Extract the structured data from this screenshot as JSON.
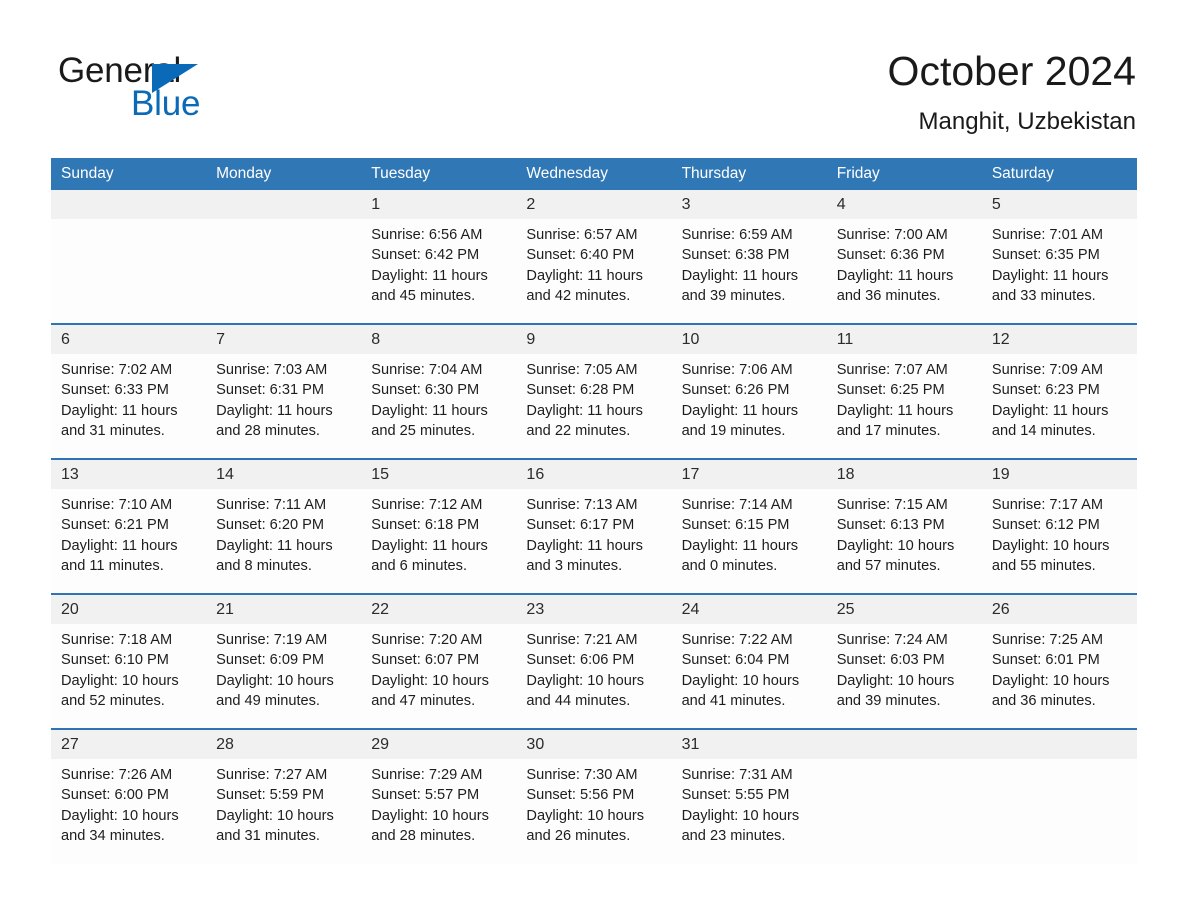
{
  "brand": {
    "name_part1": "General",
    "name_part2": "Blue",
    "triangle_icon": "triangle-icon",
    "accent_color": "#0b6ab8"
  },
  "header": {
    "month_title": "October 2024",
    "location": "Manghit, Uzbekistan"
  },
  "theme": {
    "header_blue": "#3077b5",
    "rule_blue": "#2e74b5",
    "daynum_band": "#f1f1f1"
  },
  "calendar": {
    "day_headers": [
      "Sunday",
      "Monday",
      "Tuesday",
      "Wednesday",
      "Thursday",
      "Friday",
      "Saturday"
    ],
    "weeks": [
      [
        {
          "day": "",
          "sunrise": "",
          "sunset": "",
          "daylight": ""
        },
        {
          "day": "",
          "sunrise": "",
          "sunset": "",
          "daylight": ""
        },
        {
          "day": "1",
          "sunrise": "Sunrise: 6:56 AM",
          "sunset": "Sunset: 6:42 PM",
          "daylight": "Daylight: 11 hours and 45 minutes."
        },
        {
          "day": "2",
          "sunrise": "Sunrise: 6:57 AM",
          "sunset": "Sunset: 6:40 PM",
          "daylight": "Daylight: 11 hours and 42 minutes."
        },
        {
          "day": "3",
          "sunrise": "Sunrise: 6:59 AM",
          "sunset": "Sunset: 6:38 PM",
          "daylight": "Daylight: 11 hours and 39 minutes."
        },
        {
          "day": "4",
          "sunrise": "Sunrise: 7:00 AM",
          "sunset": "Sunset: 6:36 PM",
          "daylight": "Daylight: 11 hours and 36 minutes."
        },
        {
          "day": "5",
          "sunrise": "Sunrise: 7:01 AM",
          "sunset": "Sunset: 6:35 PM",
          "daylight": "Daylight: 11 hours and 33 minutes."
        }
      ],
      [
        {
          "day": "6",
          "sunrise": "Sunrise: 7:02 AM",
          "sunset": "Sunset: 6:33 PM",
          "daylight": "Daylight: 11 hours and 31 minutes."
        },
        {
          "day": "7",
          "sunrise": "Sunrise: 7:03 AM",
          "sunset": "Sunset: 6:31 PM",
          "daylight": "Daylight: 11 hours and 28 minutes."
        },
        {
          "day": "8",
          "sunrise": "Sunrise: 7:04 AM",
          "sunset": "Sunset: 6:30 PM",
          "daylight": "Daylight: 11 hours and 25 minutes."
        },
        {
          "day": "9",
          "sunrise": "Sunrise: 7:05 AM",
          "sunset": "Sunset: 6:28 PM",
          "daylight": "Daylight: 11 hours and 22 minutes."
        },
        {
          "day": "10",
          "sunrise": "Sunrise: 7:06 AM",
          "sunset": "Sunset: 6:26 PM",
          "daylight": "Daylight: 11 hours and 19 minutes."
        },
        {
          "day": "11",
          "sunrise": "Sunrise: 7:07 AM",
          "sunset": "Sunset: 6:25 PM",
          "daylight": "Daylight: 11 hours and 17 minutes."
        },
        {
          "day": "12",
          "sunrise": "Sunrise: 7:09 AM",
          "sunset": "Sunset: 6:23 PM",
          "daylight": "Daylight: 11 hours and 14 minutes."
        }
      ],
      [
        {
          "day": "13",
          "sunrise": "Sunrise: 7:10 AM",
          "sunset": "Sunset: 6:21 PM",
          "daylight": "Daylight: 11 hours and 11 minutes."
        },
        {
          "day": "14",
          "sunrise": "Sunrise: 7:11 AM",
          "sunset": "Sunset: 6:20 PM",
          "daylight": "Daylight: 11 hours and 8 minutes."
        },
        {
          "day": "15",
          "sunrise": "Sunrise: 7:12 AM",
          "sunset": "Sunset: 6:18 PM",
          "daylight": "Daylight: 11 hours and 6 minutes."
        },
        {
          "day": "16",
          "sunrise": "Sunrise: 7:13 AM",
          "sunset": "Sunset: 6:17 PM",
          "daylight": "Daylight: 11 hours and 3 minutes."
        },
        {
          "day": "17",
          "sunrise": "Sunrise: 7:14 AM",
          "sunset": "Sunset: 6:15 PM",
          "daylight": "Daylight: 11 hours and 0 minutes."
        },
        {
          "day": "18",
          "sunrise": "Sunrise: 7:15 AM",
          "sunset": "Sunset: 6:13 PM",
          "daylight": "Daylight: 10 hours and 57 minutes."
        },
        {
          "day": "19",
          "sunrise": "Sunrise: 7:17 AM",
          "sunset": "Sunset: 6:12 PM",
          "daylight": "Daylight: 10 hours and 55 minutes."
        }
      ],
      [
        {
          "day": "20",
          "sunrise": "Sunrise: 7:18 AM",
          "sunset": "Sunset: 6:10 PM",
          "daylight": "Daylight: 10 hours and 52 minutes."
        },
        {
          "day": "21",
          "sunrise": "Sunrise: 7:19 AM",
          "sunset": "Sunset: 6:09 PM",
          "daylight": "Daylight: 10 hours and 49 minutes."
        },
        {
          "day": "22",
          "sunrise": "Sunrise: 7:20 AM",
          "sunset": "Sunset: 6:07 PM",
          "daylight": "Daylight: 10 hours and 47 minutes."
        },
        {
          "day": "23",
          "sunrise": "Sunrise: 7:21 AM",
          "sunset": "Sunset: 6:06 PM",
          "daylight": "Daylight: 10 hours and 44 minutes."
        },
        {
          "day": "24",
          "sunrise": "Sunrise: 7:22 AM",
          "sunset": "Sunset: 6:04 PM",
          "daylight": "Daylight: 10 hours and 41 minutes."
        },
        {
          "day": "25",
          "sunrise": "Sunrise: 7:24 AM",
          "sunset": "Sunset: 6:03 PM",
          "daylight": "Daylight: 10 hours and 39 minutes."
        },
        {
          "day": "26",
          "sunrise": "Sunrise: 7:25 AM",
          "sunset": "Sunset: 6:01 PM",
          "daylight": "Daylight: 10 hours and 36 minutes."
        }
      ],
      [
        {
          "day": "27",
          "sunrise": "Sunrise: 7:26 AM",
          "sunset": "Sunset: 6:00 PM",
          "daylight": "Daylight: 10 hours and 34 minutes."
        },
        {
          "day": "28",
          "sunrise": "Sunrise: 7:27 AM",
          "sunset": "Sunset: 5:59 PM",
          "daylight": "Daylight: 10 hours and 31 minutes."
        },
        {
          "day": "29",
          "sunrise": "Sunrise: 7:29 AM",
          "sunset": "Sunset: 5:57 PM",
          "daylight": "Daylight: 10 hours and 28 minutes."
        },
        {
          "day": "30",
          "sunrise": "Sunrise: 7:30 AM",
          "sunset": "Sunset: 5:56 PM",
          "daylight": "Daylight: 10 hours and 26 minutes."
        },
        {
          "day": "31",
          "sunrise": "Sunrise: 7:31 AM",
          "sunset": "Sunset: 5:55 PM",
          "daylight": "Daylight: 10 hours and 23 minutes."
        },
        {
          "day": "",
          "sunrise": "",
          "sunset": "",
          "daylight": ""
        },
        {
          "day": "",
          "sunrise": "",
          "sunset": "",
          "daylight": ""
        }
      ]
    ]
  }
}
